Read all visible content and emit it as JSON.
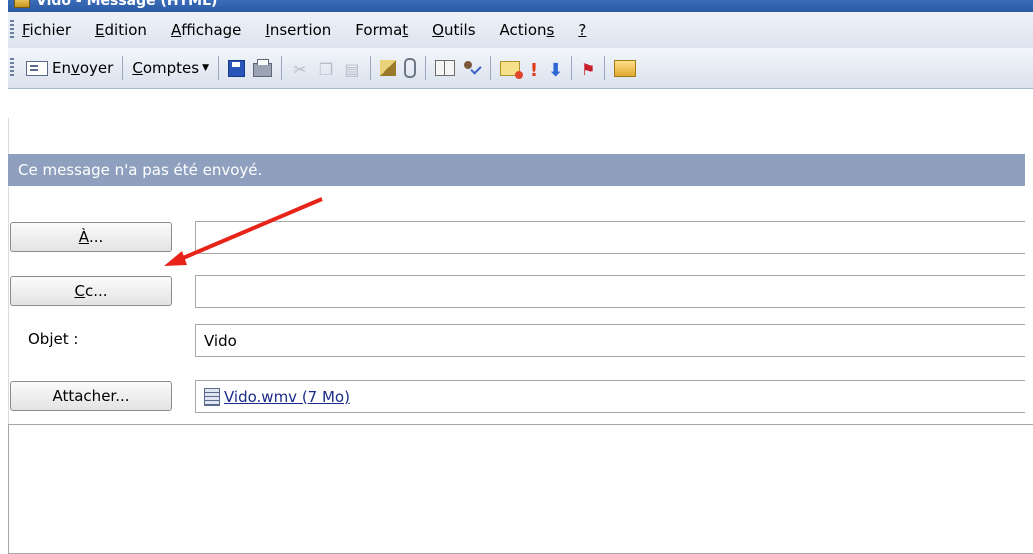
{
  "window": {
    "title": "Vido - Message (HTML)"
  },
  "menu": [
    {
      "pre": "",
      "u": "F",
      "post": "ichier"
    },
    {
      "pre": "",
      "u": "E",
      "post": "dition"
    },
    {
      "pre": "",
      "u": "A",
      "post": "ffichage"
    },
    {
      "pre": "",
      "u": "I",
      "post": "nsertion"
    },
    {
      "pre": "Forma",
      "u": "t",
      "post": ""
    },
    {
      "pre": "",
      "u": "O",
      "post": "utils"
    },
    {
      "pre": "Action",
      "u": "s",
      "post": ""
    },
    {
      "pre": "",
      "u": "?",
      "post": ""
    }
  ],
  "toolbar": {
    "send_pre": "En",
    "send_u": "v",
    "send_post": "oyer",
    "accounts_u": "C",
    "accounts_post": "omptes",
    "icons": [
      "send-icon",
      "save-icon",
      "print-icon",
      "cut-icon",
      "copy-icon",
      "paste-icon",
      "edit-icon",
      "attach-icon",
      "address-book-icon",
      "check-names-icon",
      "mail-options-icon",
      "high-importance-icon",
      "low-importance-icon",
      "flag-icon",
      "folder-icon"
    ]
  },
  "info_bar": "Ce message n'a pas été envoyé.",
  "to": {
    "btn_u": "À",
    "btn_post": "...",
    "value": ""
  },
  "cc": {
    "btn_u": "C",
    "btn_post": "c...",
    "value": ""
  },
  "subject": {
    "label_pre": "Ob",
    "label_u": "j",
    "label_post": "et :",
    "value": "Vido"
  },
  "attach": {
    "btn_label": "Attacher...",
    "file": "Vido.wmv (7 Mo)"
  },
  "colors": {
    "info_bar": "#8ea0bd",
    "title_bar": "#2a5aa6",
    "arrow": "#e8231a"
  }
}
